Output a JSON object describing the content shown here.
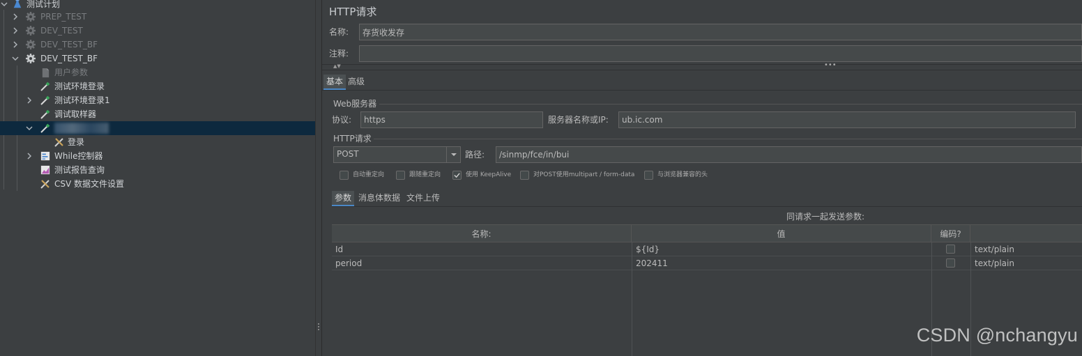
{
  "tree": {
    "root": "测试计划",
    "items": [
      {
        "label": "PREP_TEST",
        "state": "disabled"
      },
      {
        "label": "DEV_TEST",
        "state": "disabled"
      },
      {
        "label": "DEV_TEST_BF",
        "state": "disabled"
      },
      {
        "label": "DEV_TEST_BF",
        "state": "enabled"
      },
      {
        "label": "用户参数",
        "state": "disabled"
      },
      {
        "label": "测试环境登录"
      },
      {
        "label": "测试环境登录1"
      },
      {
        "label": "调试取样器"
      },
      {
        "label": ""
      },
      {
        "label": "登录"
      },
      {
        "label": "While控制器"
      },
      {
        "label": "测试报告查询"
      },
      {
        "label": "CSV 数据文件设置"
      }
    ]
  },
  "panel": {
    "title": "HTTP请求",
    "name_label": "名称:",
    "name_value": "存货收发存",
    "comment_label": "注释:",
    "comment_value": "",
    "tabs": [
      "基本",
      "高级"
    ],
    "web_server": {
      "group_title": "Web服务器",
      "protocol_label": "协议:",
      "protocol_value": "https",
      "server_label": "服务器名称或IP:",
      "server_value": "ub.ic.com"
    },
    "http_request": {
      "group_title": "HTTP请求",
      "method": "POST",
      "path_label": "路径:",
      "path_value": "/sinmp/fce/in/bui"
    },
    "options": [
      {
        "label": "自动重定向",
        "checked": false
      },
      {
        "label": "跟随重定向",
        "checked": false
      },
      {
        "label": "使用 KeepAlive",
        "checked": true
      },
      {
        "label": "对POST使用multipart / form-data",
        "checked": false
      },
      {
        "label": "与浏览器兼容的头",
        "checked": false
      }
    ],
    "sub_tabs": [
      "参数",
      "消息体数据",
      "文件上传"
    ],
    "params_caption": "同请求一起发送参数:",
    "table": {
      "headers": [
        "名称:",
        "值",
        "编码?",
        ""
      ],
      "rows": [
        {
          "name": "Id",
          "value": "${Id}",
          "encode": false,
          "content_type": "text/plain"
        },
        {
          "name": "period",
          "value": "202411",
          "encode": false,
          "content_type": "text/plain"
        }
      ]
    }
  },
  "watermark": "CSDN @nchangyu"
}
